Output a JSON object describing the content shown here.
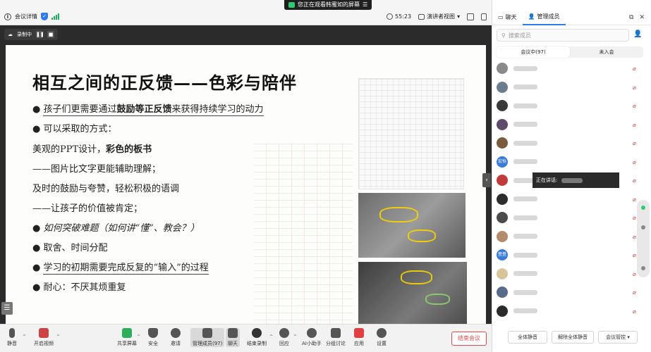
{
  "banner": {
    "text": "您正在观看韩蜜如的屏幕",
    "menu": "☰"
  },
  "topbar": {
    "meeting_details": "会议详情",
    "timer": "55:23",
    "view_label": "演讲者视图",
    "chat_tab": "聊天",
    "members_tab": "管理成员"
  },
  "recording": {
    "label": "录制中"
  },
  "slide": {
    "title": "相互之间的正反馈——色彩与陪伴",
    "bullet1_a": "孩子们更需要通过",
    "bullet1_b": "鼓励等正反馈",
    "bullet1_c": "来获得持续学习的动力",
    "bullet2": "可以采取的方式：",
    "line3_a": "美观的PPT设计，",
    "line3_b": "彩色的板书",
    "line4": "——图片比文字更能辅助理解；",
    "line5": "及时的鼓励与夸赞，轻松积极的语调",
    "line6": "——让孩子的价值被肯定；",
    "bullet7": "如何突破难题（如何讲“懂”、教会？）",
    "bullet8": "取舍、时间分配",
    "bullet9": "学习的初期需要完成反复的“输入”的过程",
    "bullet10": "耐心：不厌其烦重复"
  },
  "toolbar": {
    "mute": "静音",
    "video": "开启视频",
    "share": "共享屏幕",
    "security": "安全",
    "invite": "邀请",
    "members": "管理成员(97)",
    "chat": "聊天",
    "record": "结束录制",
    "react": "回应",
    "ai": "AI小助手",
    "breakout": "分组讨论",
    "apps": "应用",
    "settings": "设置",
    "end": "结束会议"
  },
  "panel": {
    "search_placeholder": "搜索成员",
    "in_meeting": "会议中(97)",
    "not_joined": "未入会",
    "speaking": "正在讲话:",
    "mute_all": "全体静音",
    "unmute_all": "解除全体静音",
    "meeting_control": "会议管控"
  },
  "members": [
    {
      "avatar": "",
      "color": "#8a8a8a"
    },
    {
      "avatar": "",
      "color": "#6b7c8f"
    },
    {
      "avatar": "",
      "color": "#3a3a3a"
    },
    {
      "avatar": "",
      "color": "#5e4b6b"
    },
    {
      "avatar": "",
      "color": "#7a5c3e"
    },
    {
      "avatar": "宏怡",
      "color": "#3a7bd5"
    },
    {
      "avatar": "",
      "color": "#c23b3b"
    },
    {
      "avatar": "",
      "color": "#2d2d2d"
    },
    {
      "avatar": "",
      "color": "#4b4b4b"
    },
    {
      "avatar": "",
      "color": "#b38b6d"
    },
    {
      "avatar": "萱萱",
      "color": "#3a7bd5"
    },
    {
      "avatar": "",
      "color": "#d8c59a"
    },
    {
      "avatar": "",
      "color": "#5a6b8a"
    },
    {
      "avatar": "",
      "color": "#2b2b2b"
    },
    {
      "avatar": "",
      "color": "#e06a2b"
    },
    {
      "avatar": "",
      "color": "#8a8a8a"
    }
  ]
}
